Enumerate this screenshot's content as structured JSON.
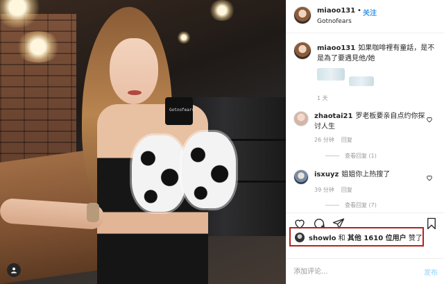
{
  "post": {
    "photo": {
      "mug_text": "Gotnofears"
    },
    "header": {
      "username": "miaoo131",
      "separator": "•",
      "follow_label": "关注",
      "subtitle": "Gotnofears"
    },
    "caption": {
      "username": "miaoo131",
      "text": "如果咖啡裡有童話，是不是為了要遇見他/她",
      "time": "1 天"
    },
    "comments": [
      {
        "username": "zhaotai21",
        "text": "罗老板要亲自点约你探讨人生",
        "time": "26 分钟",
        "reply_label": "回复",
        "view_replies": "查看回复 (1)"
      },
      {
        "username": "isxuyz",
        "text": "姐姐你上热搜了",
        "time": "39 分钟",
        "reply_label": "回复",
        "view_replies": "查看回复 (7)"
      }
    ],
    "likes": {
      "prefix_user": "showlo",
      "connector": " 和 ",
      "others": "其他 1610 位用户",
      "suffix": " 赞了"
    },
    "add_comment": {
      "placeholder": "添加评论...",
      "post_label": "发布"
    },
    "colors": {
      "link_blue": "#3897f0",
      "highlight_red": "#b3221a",
      "muted_gray": "#999999"
    },
    "icons": [
      "heart-icon",
      "comment-icon",
      "share-icon",
      "bookmark-icon",
      "user-tag-icon"
    ]
  }
}
